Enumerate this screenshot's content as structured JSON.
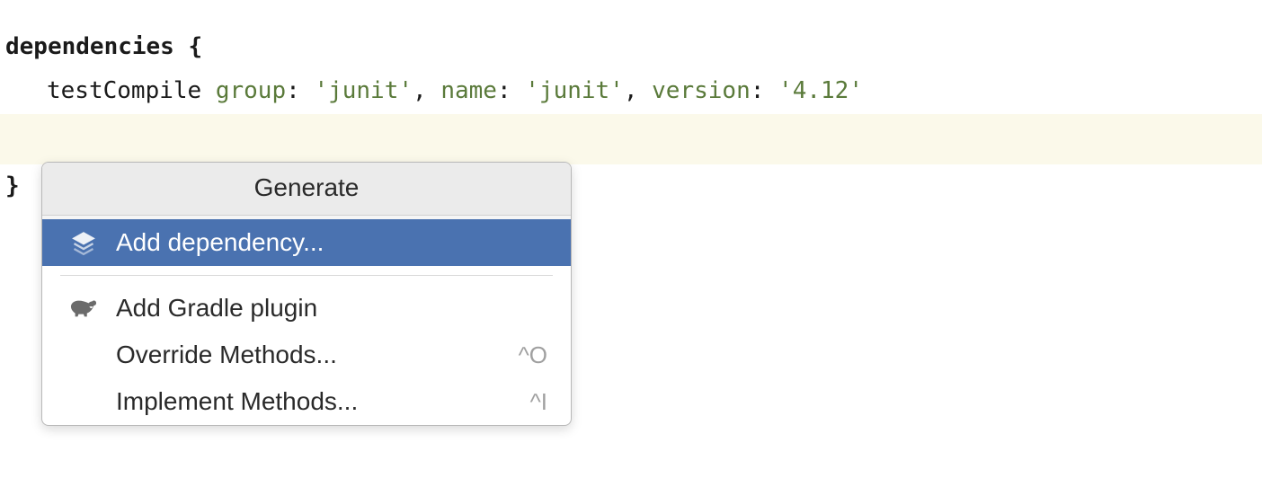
{
  "code": {
    "line1_keyword": "dependencies",
    "line1_brace": " {",
    "line2_method": "testCompile ",
    "line2_group_key": "group",
    "line2_group_val": "'junit'",
    "line2_name_key": "name",
    "line2_name_val": "'junit'",
    "line2_version_key": "version",
    "line2_version_val": "'4.12'",
    "line4_brace": "}",
    "colon": ":",
    "comma_space": ", "
  },
  "popup": {
    "title": "Generate",
    "items": [
      {
        "label": "Add dependency...",
        "shortcut": "",
        "icon": "layers-icon"
      },
      {
        "label": "Add Gradle plugin",
        "shortcut": "",
        "icon": "elephant-icon"
      },
      {
        "label": "Override Methods...",
        "shortcut": "^O",
        "icon": ""
      },
      {
        "label": "Implement Methods...",
        "shortcut": "^I",
        "icon": ""
      }
    ]
  }
}
